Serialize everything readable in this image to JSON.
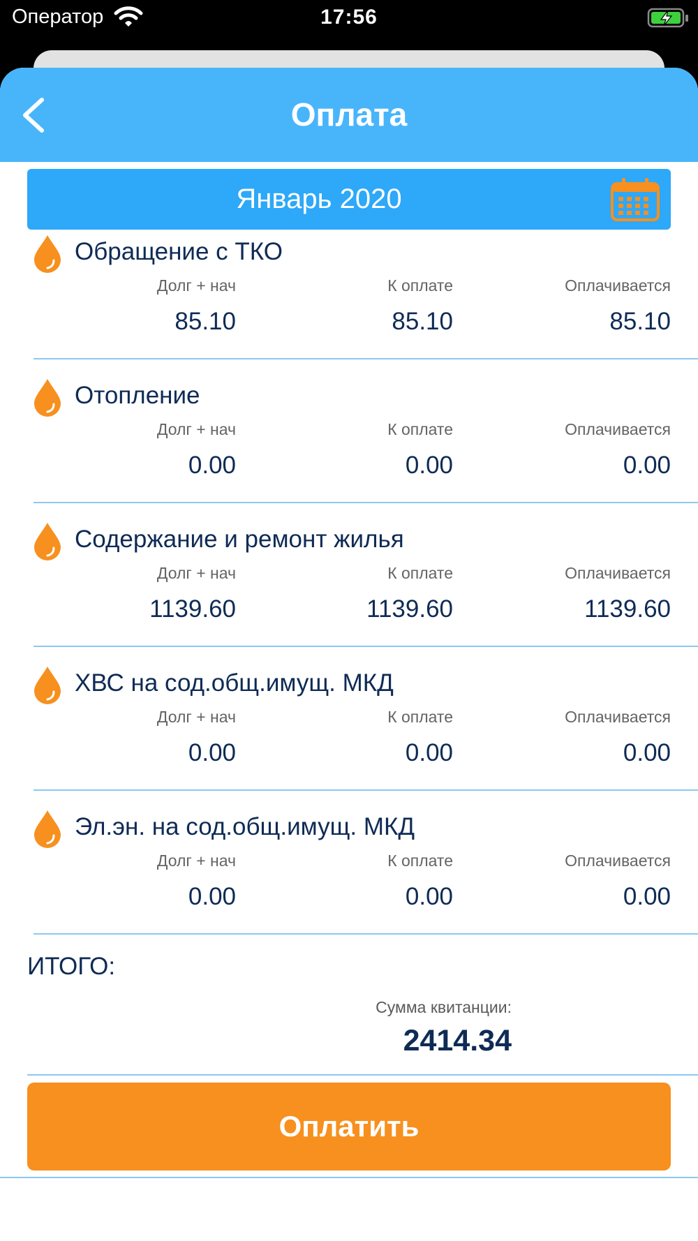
{
  "status_bar": {
    "carrier": "Оператор",
    "time": "17:56"
  },
  "header": {
    "title": "Оплата"
  },
  "month": {
    "label": "Январь 2020"
  },
  "columns": {
    "debt": "Долг + нач",
    "to_pay": "К оплате",
    "paying": "Оплачивается"
  },
  "services": [
    {
      "name": "Обращение с ТКО",
      "debt": "85.10",
      "to_pay": "85.10",
      "paying": "85.10"
    },
    {
      "name": "Отопление",
      "debt": "0.00",
      "to_pay": "0.00",
      "paying": "0.00"
    },
    {
      "name": "Содержание и ремонт жилья",
      "debt": "1139.60",
      "to_pay": "1139.60",
      "paying": "1139.60"
    },
    {
      "name": "ХВС на сод.общ.имущ. МКД",
      "debt": "0.00",
      "to_pay": "0.00",
      "paying": "0.00"
    },
    {
      "name": "Эл.эн. на сод.общ.имущ. МКД",
      "debt": "0.00",
      "to_pay": "0.00",
      "paying": "0.00"
    }
  ],
  "total": {
    "title": "ИТОГО:",
    "sum_label": "Сумма квитанции:",
    "sum_value": "2414.34"
  },
  "pay_button": {
    "label": "Оплатить"
  },
  "colors": {
    "header": "#48b5fb",
    "month_bar": "#2ea8f8",
    "accent": "#f7901e",
    "text": "#0f2b55",
    "divider": "#8cc8f2"
  },
  "icons": {
    "back": "chevron-left-icon",
    "calendar": "calendar-icon",
    "service": "drop-icon",
    "wifi": "wifi-icon",
    "battery": "battery-charging-icon"
  }
}
